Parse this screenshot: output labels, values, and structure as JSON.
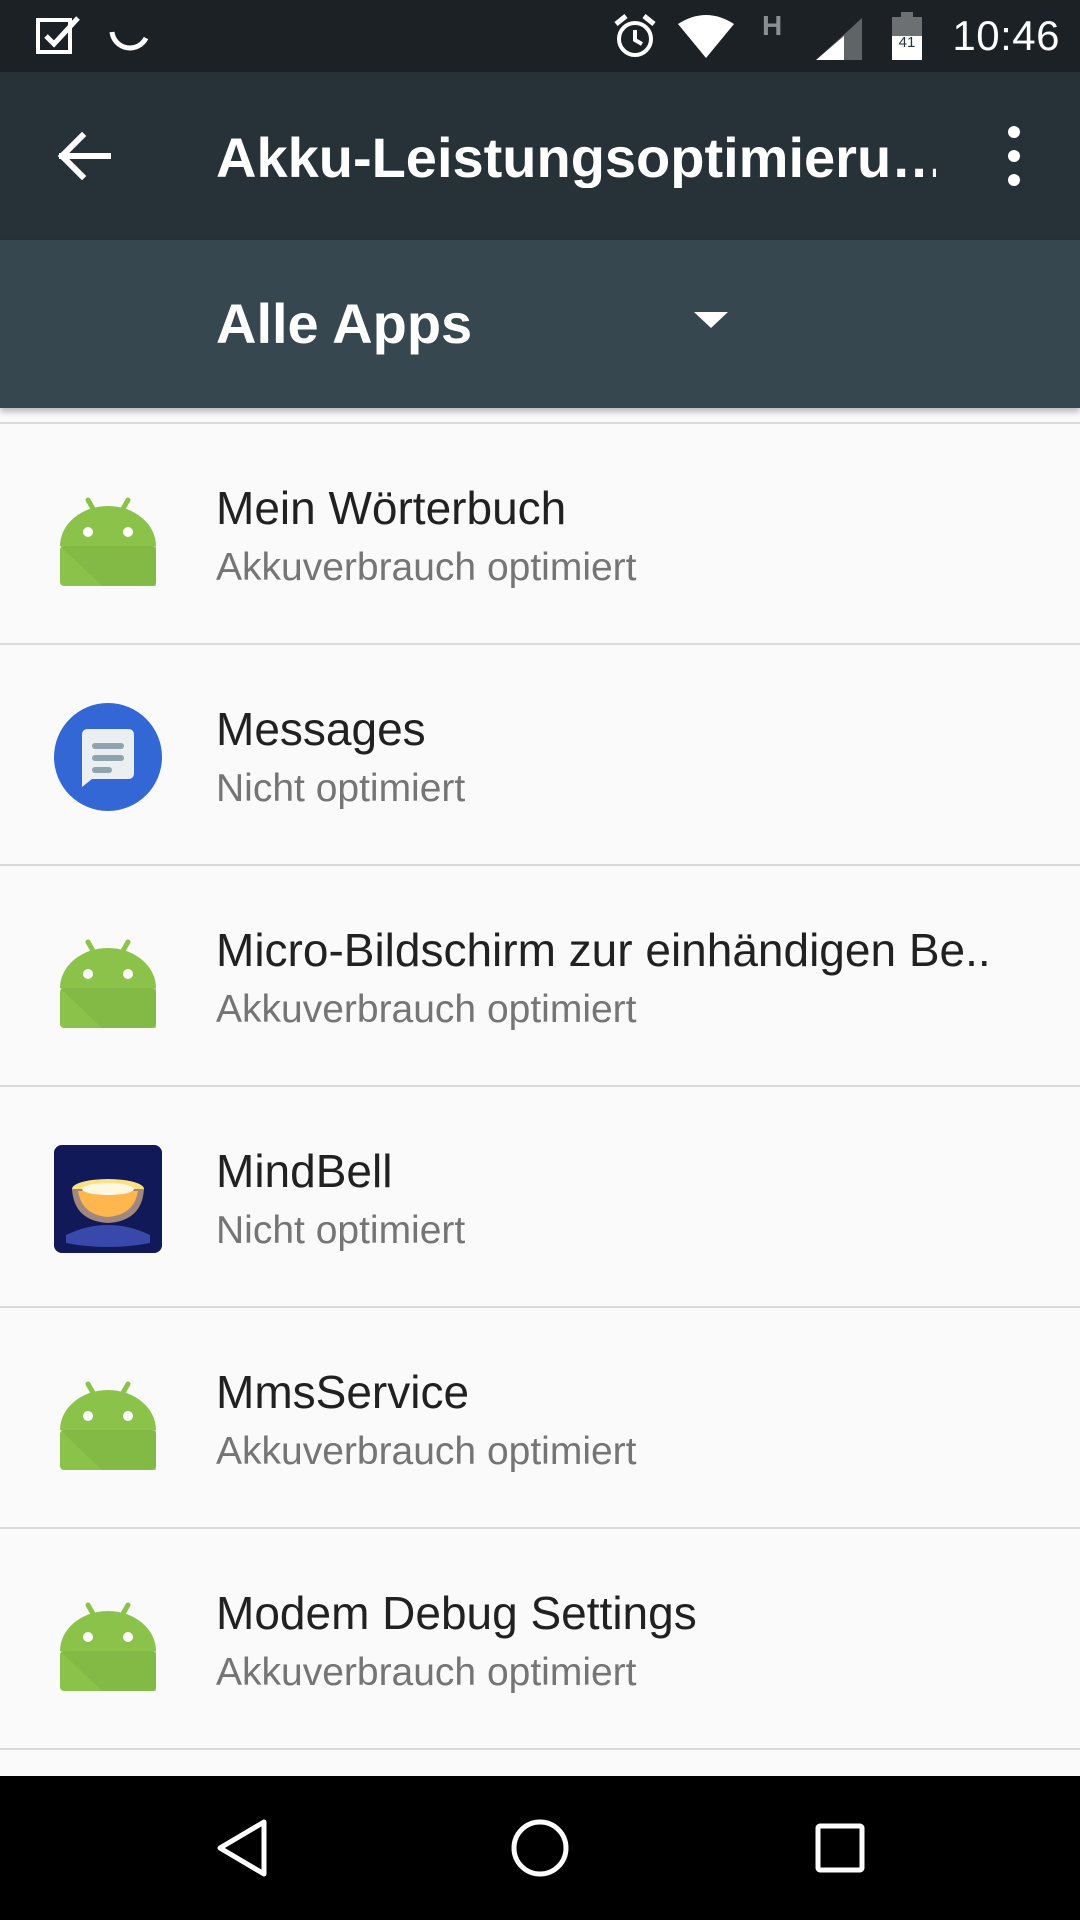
{
  "status_bar": {
    "time": "10:46",
    "network_type": "H",
    "battery_level": "41",
    "left_icons": [
      "task-check-icon",
      "sync-spinner-icon"
    ],
    "right_icons": [
      "alarm-icon",
      "wifi-icon",
      "network-type-icon",
      "cell-signal-icon",
      "battery-icon"
    ]
  },
  "app_bar": {
    "title": "Akku-Leistungsoptimieru…",
    "back_icon": "arrow-left-icon",
    "menu_icon": "more-vert-icon"
  },
  "filter": {
    "selected": "Alle Apps",
    "caret_icon": "dropdown-caret-icon"
  },
  "apps": [
    {
      "name": "Mein Wörterbuch",
      "status": "Akkuverbrauch optimiert",
      "icon": "android-robot-icon"
    },
    {
      "name": "Messages",
      "status": "Nicht optimiert",
      "icon": "messages-app-icon"
    },
    {
      "name": "Micro-Bildschirm zur einhändigen Be..",
      "status": "Akkuverbrauch optimiert",
      "icon": "android-robot-icon"
    },
    {
      "name": "MindBell",
      "status": "Nicht optimiert",
      "icon": "mindbell-bowl-icon"
    },
    {
      "name": "MmsService",
      "status": "Akkuverbrauch optimiert",
      "icon": "android-robot-icon"
    },
    {
      "name": "Modem Debug Settings",
      "status": "Akkuverbrauch optimiert",
      "icon": "android-robot-icon"
    }
  ],
  "nav_bar": {
    "icons": [
      "nav-back-icon",
      "nav-home-icon",
      "nav-recents-icon"
    ]
  },
  "colors": {
    "status_bar": "#1b2125",
    "app_bar": "#263238",
    "filter_bar": "#37474f",
    "android_green": "#8bc34a",
    "messages_blue": "#3367d6"
  }
}
